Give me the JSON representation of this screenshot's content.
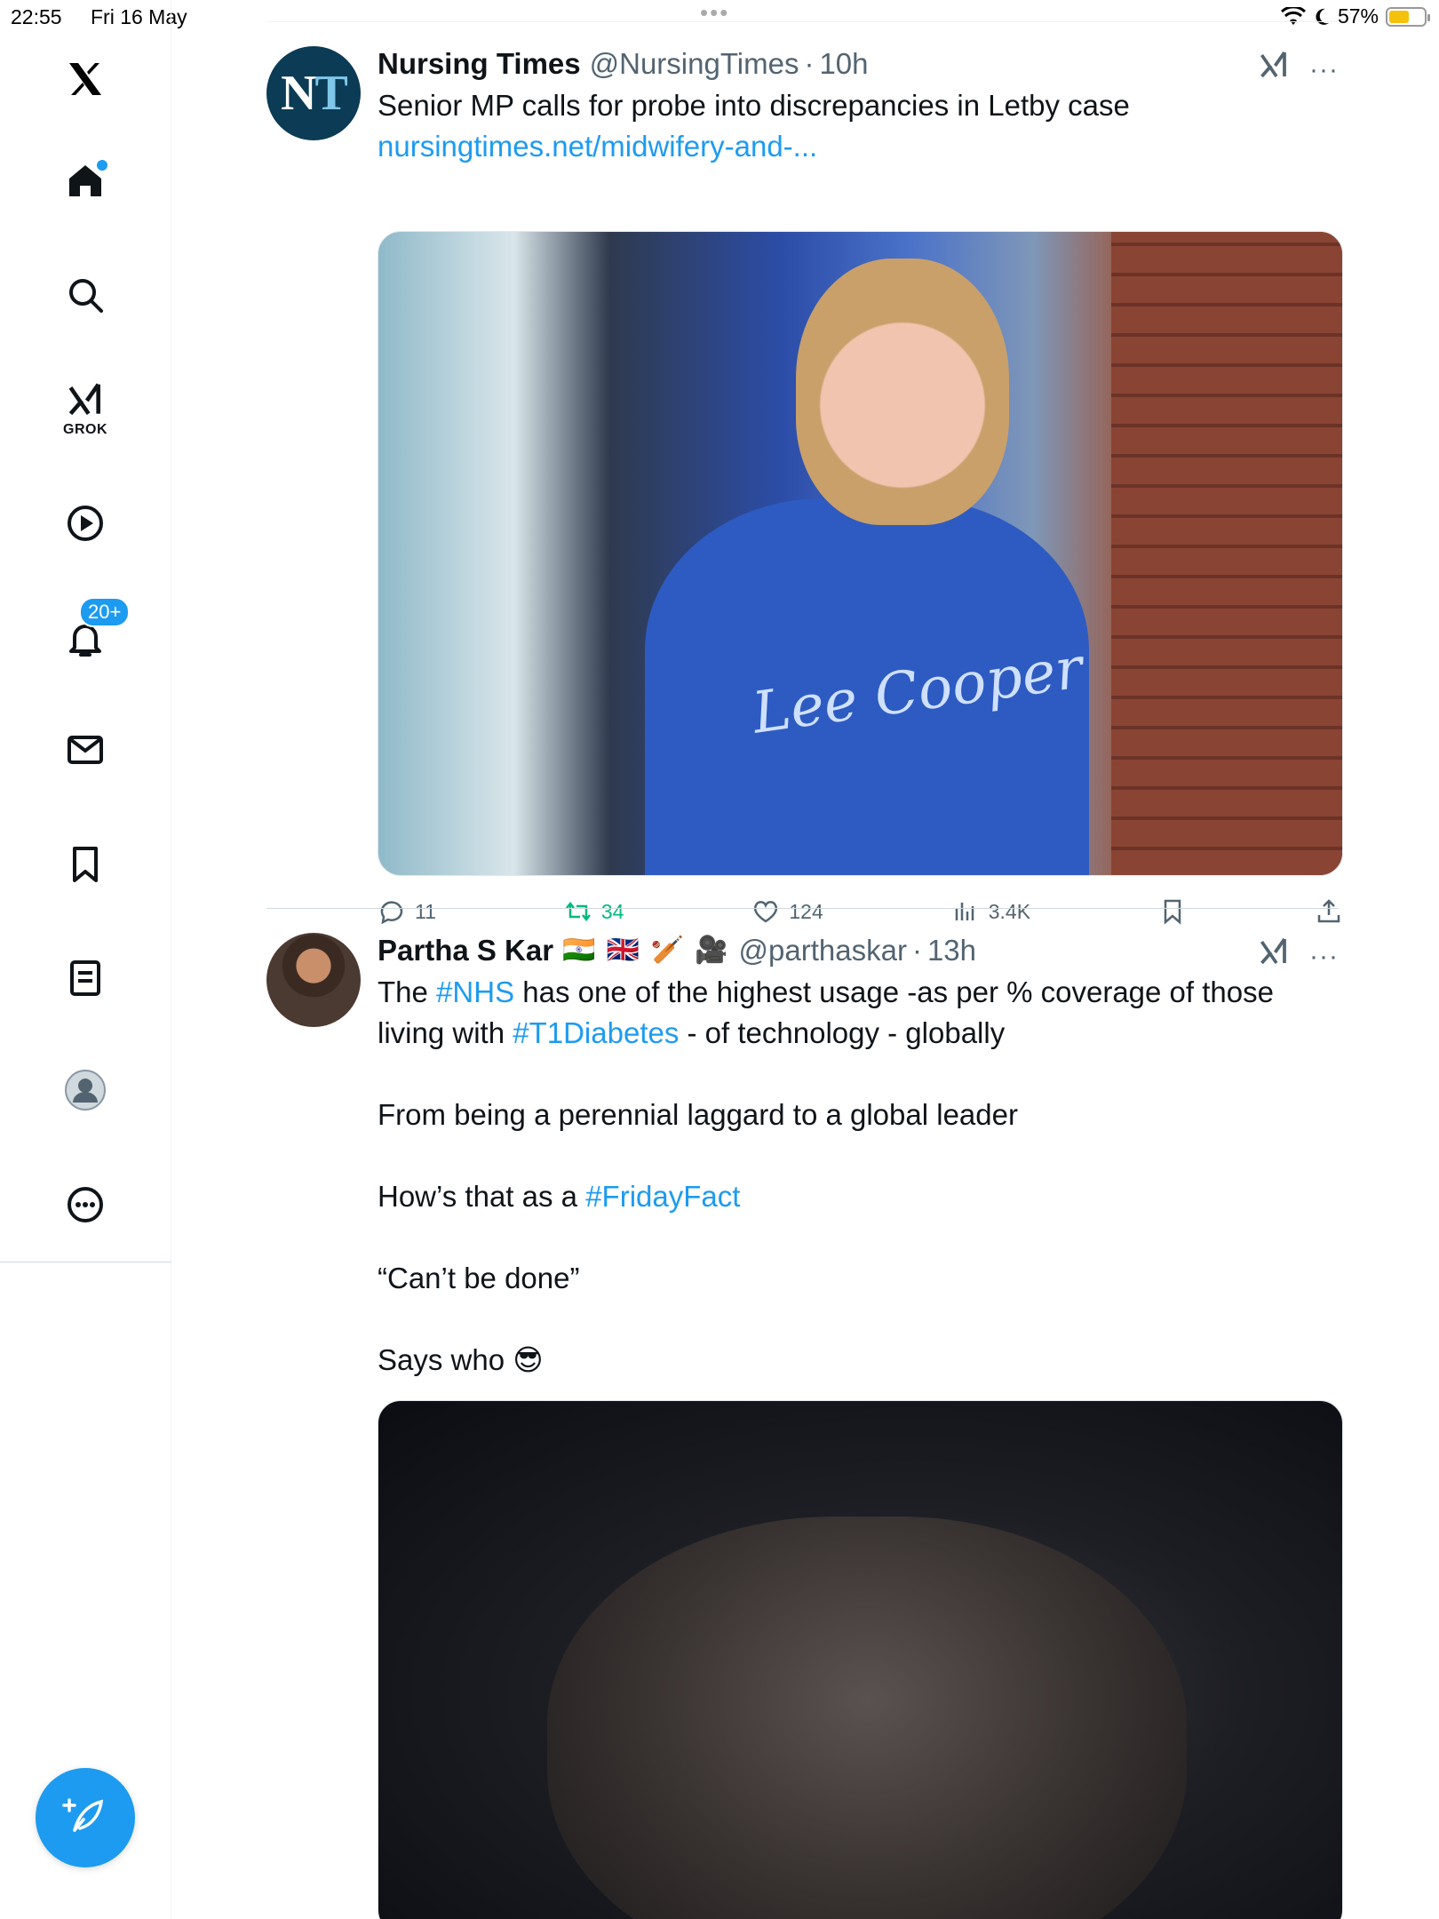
{
  "status_bar": {
    "time": "22:55",
    "date": "Fri 16 May",
    "battery": "57%",
    "battery_level": 0.57
  },
  "sidebar": {
    "logo": "x-logo-icon",
    "items": [
      {
        "name": "home",
        "icon": "home-icon",
        "has_dot": true
      },
      {
        "name": "explore",
        "icon": "search-icon"
      },
      {
        "name": "grok",
        "icon": "grok-icon",
        "label": "GROK"
      },
      {
        "name": "video",
        "icon": "play-icon"
      },
      {
        "name": "notifications",
        "icon": "bell-icon",
        "badge": "20+"
      },
      {
        "name": "messages",
        "icon": "mail-icon"
      },
      {
        "name": "bookmarks",
        "icon": "bookmark-icon"
      },
      {
        "name": "lists",
        "icon": "list-icon"
      },
      {
        "name": "profile",
        "icon": "profile-icon"
      },
      {
        "name": "more",
        "icon": "more-circle-icon"
      }
    ],
    "compose": "compose-icon"
  },
  "tweets": [
    {
      "name": "Nursing Times",
      "handle": "@NursingTimes",
      "dot": "·",
      "time": "10h",
      "avatar_text_a": "N",
      "avatar_text_b": "T",
      "text": "Senior MP calls for probe into discrepancies in Letby case",
      "link": "nursingtimes.net/midwifery-and-...",
      "media_text": "Lee Cooper",
      "stats": {
        "replies": "11",
        "reposts": "34",
        "likes": "124",
        "views": "3.4K"
      }
    },
    {
      "name": "Partha S Kar",
      "flags": "🇮🇳 🇬🇧 🏏 🎥",
      "handle": "@parthaskar",
      "dot": "·",
      "time": "13h",
      "line1_a": "The ",
      "line1_tag": "#NHS",
      "line1_b": " has one of the highest usage -as per % coverage of those",
      "line2_a": "living with ",
      "line2_tag": "#T1Diabetes",
      "line2_b": " - of technology - globally",
      "para2": "From being a perennial laggard to a global leader",
      "para3_a": "How’s that as a ",
      "para3_tag": "#FridayFact",
      "para4": "“Can’t be done”",
      "para5": "Says who 😎"
    }
  ],
  "colors": {
    "accent": "#1d9bf0",
    "repost": "#00ba7c",
    "muted": "#536471"
  }
}
